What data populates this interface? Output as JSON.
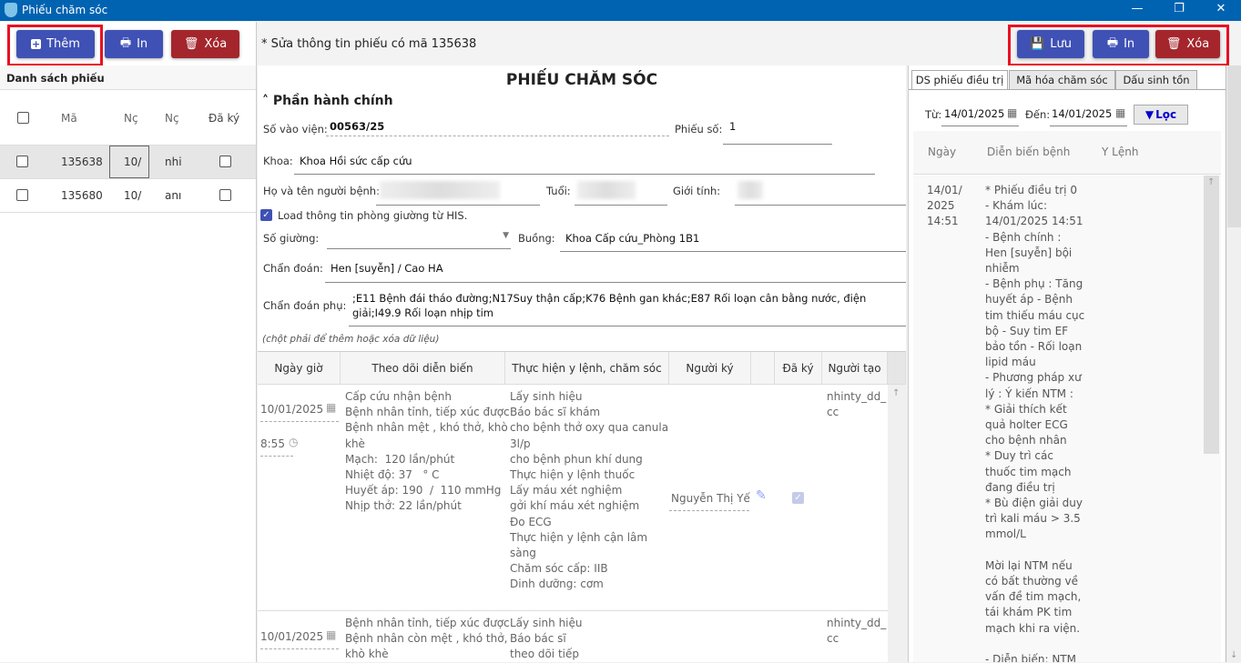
{
  "window": {
    "title": "Phiếu chăm sóc",
    "controls": [
      "—",
      "❐",
      "✕"
    ]
  },
  "left_toolbar": {
    "add": "Thêm",
    "print": "In",
    "delete": "Xóa"
  },
  "list": {
    "title": "Danh sách phiếu",
    "columns": [
      "Mã",
      "Nç",
      "Nç",
      "Đã ký"
    ],
    "rows": [
      {
        "ma": "135638",
        "c2": "10/",
        "c3": "nhi",
        "signed": false,
        "selected": true
      },
      {
        "ma": "135680",
        "c2": "10/",
        "c3": "anı",
        "signed": false,
        "selected": false
      }
    ]
  },
  "status_text": "* Sửa thông tin phiếu có mã 135638",
  "right_toolbar": {
    "save": "Lưu",
    "print": "In",
    "delete": "Xóa"
  },
  "form": {
    "title": "PHIẾU CHĂM SÓC",
    "section": "Phần hành chính",
    "so_vao_vien_label": "Số vào viện:",
    "so_vao_vien": "00563/25",
    "phieu_so_label": "Phiếu số:",
    "phieu_so": "1",
    "khoa_label": "Khoa:",
    "khoa": "Khoa Hồi sức cấp cứu",
    "ho_ten_label": "Họ và tên người bệnh:",
    "tuoi_label": "Tuổi:",
    "gioi_tinh_label": "Giới tính:",
    "load_label": "Load thông tin phòng giường từ HIS.",
    "load_checked": true,
    "so_giuong_label": "Số giường:",
    "so_giuong": "",
    "buong_label": "Buồng:",
    "buong": "Khoa Cấp cứu_Phòng 1B1",
    "chan_doan_label": "Chẩn đoán:",
    "chan_doan": "Hen [suyễn] / Cao HA",
    "chan_doan_phu_label": "Chẩn đoán phụ:",
    "chan_doan_phu": ";E11 Bệnh đái tháo đường;N17Suy thận cấp;K76 Bệnh gan khác;E87 Rối loạn cân bằng nước, điện giải;I49.9 Rối loạn nhịp tim",
    "hint": "(chột phải để thêm hoặc xóa dữ liệu)"
  },
  "grid": {
    "columns": [
      "Ngày giờ",
      "Theo dõi diễn biến",
      "Thực hiện y lệnh, chăm sóc",
      "Người ký",
      "",
      "Đã ký",
      "Người tạo"
    ],
    "rows": [
      {
        "date": "10/01/2025",
        "time": "8:55",
        "dien_bien": "Cấp cứu nhận bệnh\nBệnh nhân tỉnh, tiếp xúc được\nBệnh nhân mệt , khó thở, khò\nkhè\nMạch:  120 lần/phút\nNhiệt độ: 37   ° C\nHuyết áp: 190  /  110 mmHg\nNhịp thở: 22 lần/phút",
        "y_lenh": "Lấy sinh hiệu\nBáo bác sĩ khám\ncho bệnh thở oxy qua canula\n3l/p\ncho bệnh phun khí dung\nThực hiện y lệnh thuốc\nLấy máu xét nghiệm\ngởi khí máu xét nghiệm\nĐo ECG\nThực hiện y lệnh cận lâm\nsàng\nChăm sóc cấp: IIB\nDinh dưỡng: cơm",
        "nguoi_ky": "Nguyễn Thị Yế",
        "signed": true,
        "nguoi_tao": "nhinty_dd_\ncc"
      },
      {
        "date": "10/01/2025",
        "time": "",
        "dien_bien": "Bệnh nhân tỉnh, tiếp xúc được\nBệnh nhân còn mệt , khó thở,\nkhò khè",
        "y_lenh": "Lấy sinh hiệu\nBáo bác sĩ\ntheo dõi tiếp",
        "nguoi_ky": "",
        "signed": false,
        "nguoi_tao": "nhinty_dd_\ncc"
      }
    ]
  },
  "right_panel": {
    "tabs": [
      "DS phiếu điều trị",
      "Mã hóa chăm sóc",
      "Dấu sinh tồn"
    ],
    "active_tab": 0,
    "from_label": "Từ:",
    "from": "14/01/2025",
    "to_label": "Đến:",
    "to": "14/01/2025",
    "filter": "Lọc",
    "columns": [
      "Ngày",
      "Diễn biến bệnh",
      "Y Lệnh"
    ],
    "row": {
      "ngay": "14/01/\n2025\n14:51",
      "dien_bien": "* Phiếu điều trị 0\n- Khám lúc:\n14/01/2025 14:51\n- Bệnh chính :\nHen [suyễn] bội\nnhiễm\n- Bệnh phụ : Tăng\nhuyết áp - Bệnh\ntim thiếu máu cục\nbộ - Suy tim EF\nbảo tồn - Rối loạn\nlipid máu\n- Phương pháp xư\nlý : Ý kiến NTM :\n* Giải thích kết\nquả holter ECG\ncho bệnh nhân\n* Duy trì các\nthuốc tim mạch\nđang điều trị\n* Bù điện giải duy\ntrì kali máu > 3.5\nmmol/L\n\nMời lại NTM nếu\ncó bất thường về\nvấn đề tim mạch,\ntái khám PK tim\nmạch khi ra viện.\n\n- Diễn biến: NTM",
      "y_lenh": ""
    }
  },
  "colors": {
    "titlebar": "#0063b1",
    "primary": "#3f51b5",
    "danger": "#a4262c",
    "highlight": "#e81123"
  }
}
